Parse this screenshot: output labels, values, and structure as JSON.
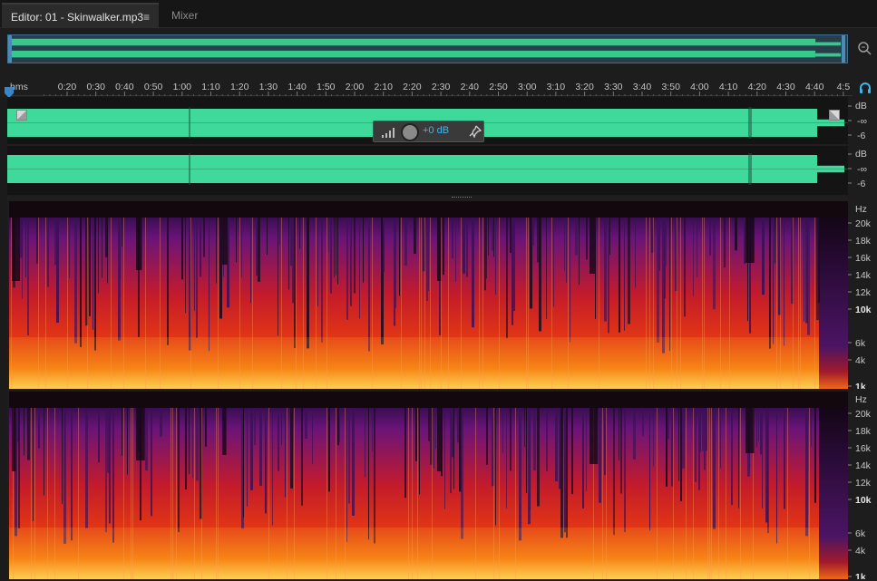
{
  "tabs": {
    "editor_label": "Editor: 01 - Skinwalker.mp3",
    "menu_glyph": "≡",
    "mixer_label": "Mixer"
  },
  "ruler": {
    "unit_label": "hms",
    "labels": [
      "0:20",
      "0:30",
      "0:40",
      "0:50",
      "1:00",
      "1:10",
      "1:20",
      "1:30",
      "1:40",
      "1:50",
      "2:00",
      "2:10",
      "2:20",
      "2:30",
      "2:40",
      "2:50",
      "3:00",
      "3:10",
      "3:20",
      "3:30",
      "3:40",
      "3:50",
      "4:00",
      "4:10",
      "4:20",
      "4:30",
      "4:40",
      "4:5"
    ]
  },
  "amplitude_scale": {
    "unit": "dB",
    "labels": [
      "-∞",
      "-6"
    ]
  },
  "hud": {
    "value": "+0 dB"
  },
  "frequency_scale": {
    "unit": "Hz",
    "labels": [
      "20k",
      "18k",
      "16k",
      "14k",
      "12k",
      "10k",
      "6k",
      "4k",
      "1k"
    ]
  },
  "colors": {
    "waveform": "#3fd99b",
    "overview_waveform": "#35c98c",
    "selection_border": "#3b6f93",
    "accent_blue": "#3cb6f0"
  },
  "icons": {
    "zoom": "magnifier-zoom-icon",
    "playhead": "playhead-marker-icon",
    "headphones": "headphones-icon",
    "fade_in": "fade-in-handle-icon",
    "fade_out": "fade-out-handle-icon",
    "gain": "gain-level-icon",
    "knob": "volume-knob-icon",
    "pin": "pin-icon"
  }
}
